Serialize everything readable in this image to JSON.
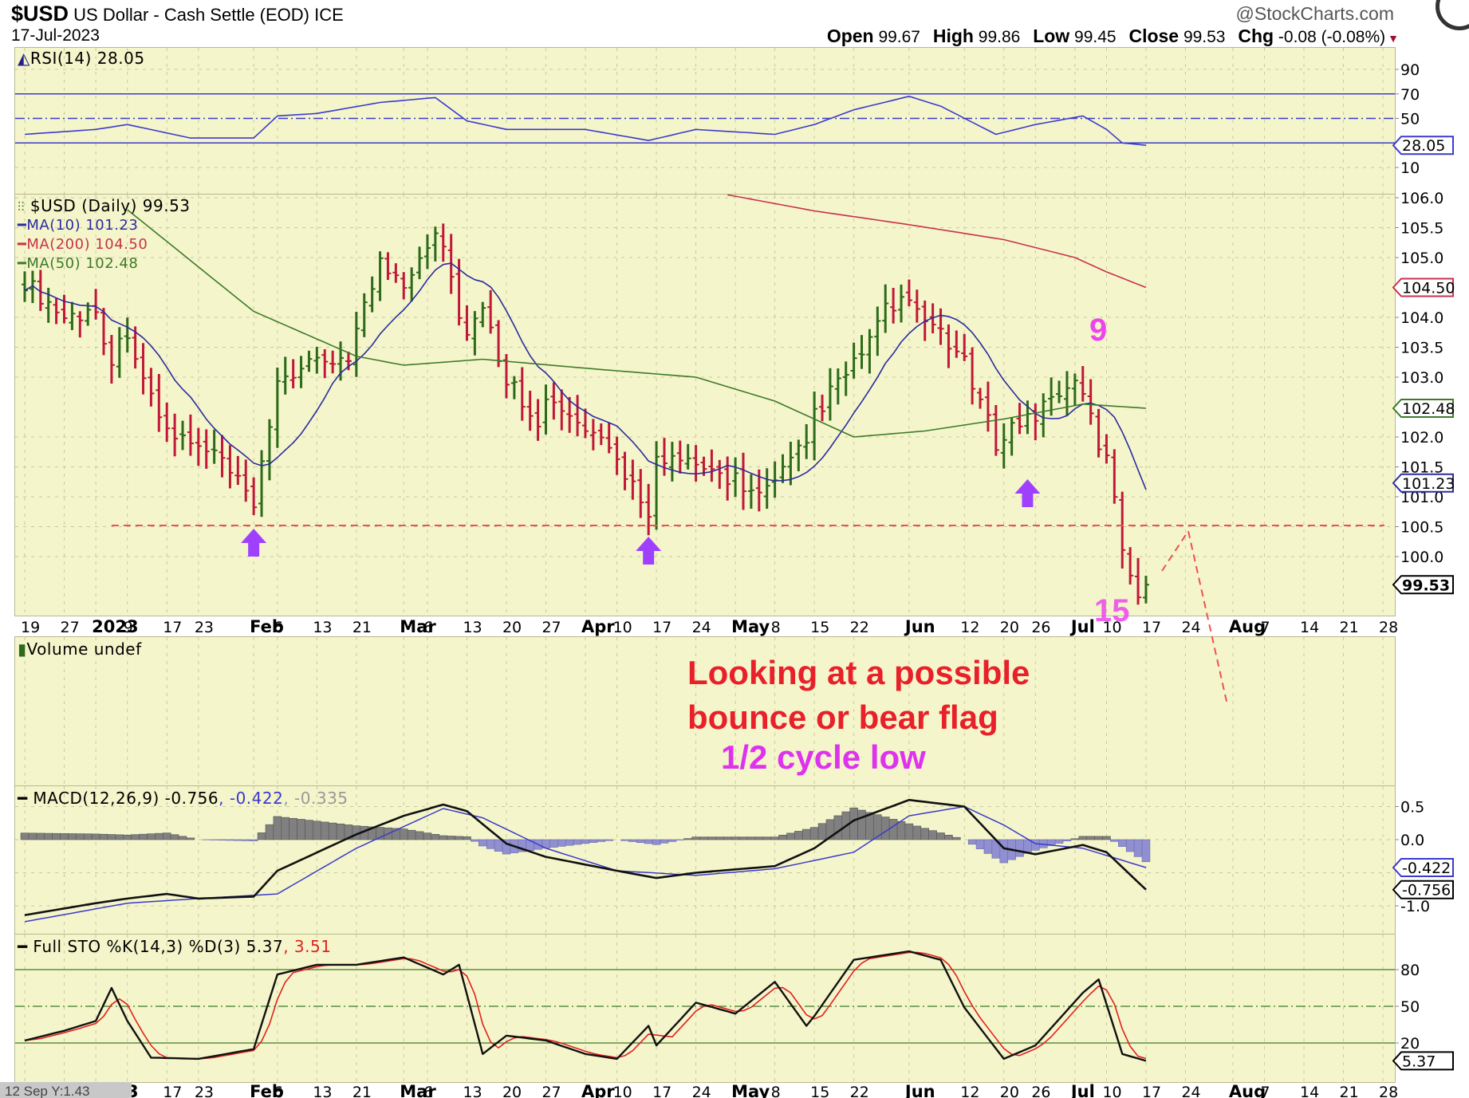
{
  "header": {
    "symbol": "$USD",
    "name": "US Dollar - Cash Settle (EOD) ICE",
    "date": "17-Jul-2023",
    "copyright": "@StockCharts.com",
    "open_label": "Open",
    "open": "99.67",
    "high_label": "High",
    "high": "99.86",
    "low_label": "Low",
    "low": "99.45",
    "close_label": "Close",
    "close": "99.53",
    "chg_label": "Chg",
    "chg": "-0.08 (-0.08%)"
  },
  "legends": {
    "rsi": "RSI(14) 28.05",
    "price": "$USD (Daily) 99.53",
    "ma10": "MA(10) 101.23",
    "ma200": "MA(200) 104.50",
    "ma50": "MA(50) 102.48",
    "volume": "Volume undef",
    "macd_name": "MACD(12,26,9) -0.756",
    "macd_signal": ", -0.422",
    "macd_hist": ", -0.335",
    "sto_name": "Full STO %K(14,3) %D(3) 5.37",
    "sto_d": ", 3.51"
  },
  "bottom_left_readout": "12 Sep Y:1.43",
  "annotations": {
    "count_high": "9",
    "count_low": "15",
    "note_line1": "Looking at a possible",
    "note_line2": "bounce or bear flag",
    "note_line3": "1/2 cycle low",
    "arrow_dates": [
      "2023-02-01",
      "2023-04-14",
      "2023-06-23"
    ],
    "support_level": 100.52
  },
  "colors": {
    "up": "#2d6a1a",
    "down": "#c01838",
    "ma10": "#2a2aa0",
    "ma50": "#3c7a28",
    "ma200": "#c8324a",
    "rsi": "#3a3acc",
    "macd": "#111111",
    "signal": "#3a3acc",
    "hist_pos": "#808080",
    "hist_neg": "#9090d0",
    "sto_k": "#111111",
    "sto_d": "#e02020",
    "note_red": "#e8202a",
    "note_magenta": "#dd33ee",
    "arrow": "#a040ff",
    "bg": "#f5f5cb"
  },
  "chart_data": {
    "type": "line",
    "title": "$USD US Dollar - Cash Settle (EOD) ICE",
    "x_range": [
      "2022-12-19",
      "2023-08-28"
    ],
    "date_labels": [
      {
        "date": "2022-12-19",
        "text": "19"
      },
      {
        "date": "2022-12-27",
        "text": "27"
      },
      {
        "date": "2023-01-03",
        "text": "2023",
        "bold": true
      },
      {
        "date": "2023-01-09",
        "text": "9"
      },
      {
        "date": "2023-01-17",
        "text": "17"
      },
      {
        "date": "2023-01-23",
        "text": "23"
      },
      {
        "date": "2023-02-01",
        "text": "Feb",
        "bold": true
      },
      {
        "date": "2023-02-06",
        "text": "6"
      },
      {
        "date": "2023-02-13",
        "text": "13"
      },
      {
        "date": "2023-02-21",
        "text": "21"
      },
      {
        "date": "2023-03-01",
        "text": "Mar",
        "bold": true
      },
      {
        "date": "2023-03-06",
        "text": "6"
      },
      {
        "date": "2023-03-13",
        "text": "13"
      },
      {
        "date": "2023-03-20",
        "text": "20"
      },
      {
        "date": "2023-03-27",
        "text": "27"
      },
      {
        "date": "2023-04-03",
        "text": "Apr",
        "bold": true
      },
      {
        "date": "2023-04-10",
        "text": "10"
      },
      {
        "date": "2023-04-17",
        "text": "17"
      },
      {
        "date": "2023-04-24",
        "text": "24"
      },
      {
        "date": "2023-05-01",
        "text": "May",
        "bold": true
      },
      {
        "date": "2023-05-08",
        "text": "8"
      },
      {
        "date": "2023-05-15",
        "text": "15"
      },
      {
        "date": "2023-05-22",
        "text": "22"
      },
      {
        "date": "2023-06-01",
        "text": "Jun",
        "bold": true
      },
      {
        "date": "2023-06-12",
        "text": "12"
      },
      {
        "date": "2023-06-20",
        "text": "20"
      },
      {
        "date": "2023-06-26",
        "text": "26"
      },
      {
        "date": "2023-07-03",
        "text": "Jul",
        "bold": true
      },
      {
        "date": "2023-07-10",
        "text": "10"
      },
      {
        "date": "2023-07-17",
        "text": "17"
      },
      {
        "date": "2023-07-24",
        "text": "24"
      },
      {
        "date": "2023-08-01",
        "text": "Aug",
        "bold": true
      },
      {
        "date": "2023-08-07",
        "text": "7"
      },
      {
        "date": "2023-08-14",
        "text": "14"
      },
      {
        "date": "2023-08-21",
        "text": "21"
      },
      {
        "date": "2023-08-28",
        "text": "28"
      }
    ],
    "price": {
      "ylim": [
        99.3,
        106.1
      ],
      "ticks": [
        106.0,
        105.5,
        105.0,
        104.0,
        103.5,
        103.0,
        102.0,
        101.5,
        101.0,
        100.5,
        100.0
      ],
      "close": [
        [
          "2022-12-19",
          104.6
        ],
        [
          "2022-12-27",
          104.0
        ],
        [
          "2023-01-03",
          104.1
        ],
        [
          "2023-01-05",
          103.3
        ],
        [
          "2023-01-09",
          103.8
        ],
        [
          "2023-01-12",
          102.6
        ],
        [
          "2023-01-17",
          102.1
        ],
        [
          "2023-01-23",
          101.8
        ],
        [
          "2023-01-26",
          101.6
        ],
        [
          "2023-02-01",
          100.8
        ],
        [
          "2023-02-03",
          102.1
        ],
        [
          "2023-02-06",
          103.0
        ],
        [
          "2023-02-13",
          103.2
        ],
        [
          "2023-02-17",
          103.4
        ],
        [
          "2023-02-21",
          103.8
        ],
        [
          "2023-02-24",
          104.9
        ],
        [
          "2023-03-01",
          104.6
        ],
        [
          "2023-03-07",
          105.5
        ],
        [
          "2023-03-08",
          105.2
        ],
        [
          "2023-03-10",
          104.1
        ],
        [
          "2023-03-13",
          103.7
        ],
        [
          "2023-03-15",
          104.1
        ],
        [
          "2023-03-20",
          103.0
        ],
        [
          "2023-03-24",
          102.3
        ],
        [
          "2023-03-27",
          102.6
        ],
        [
          "2023-04-03",
          102.1
        ],
        [
          "2023-04-10",
          101.6
        ],
        [
          "2023-04-14",
          100.8
        ],
        [
          "2023-04-17",
          101.6
        ],
        [
          "2023-04-24",
          101.5
        ],
        [
          "2023-05-01",
          101.3
        ],
        [
          "2023-05-04",
          101.0
        ],
        [
          "2023-05-08",
          101.2
        ],
        [
          "2023-05-12",
          101.9
        ],
        [
          "2023-05-15",
          102.4
        ],
        [
          "2023-05-22",
          103.2
        ],
        [
          "2023-05-26",
          104.1
        ],
        [
          "2023-05-31",
          104.3
        ],
        [
          "2023-06-02",
          104.0
        ],
        [
          "2023-06-07",
          103.8
        ],
        [
          "2023-06-12",
          103.2
        ],
        [
          "2023-06-16",
          101.9
        ],
        [
          "2023-06-20",
          102.1
        ],
        [
          "2023-06-23",
          102.3
        ],
        [
          "2023-06-26",
          102.4
        ],
        [
          "2023-06-30",
          102.9
        ],
        [
          "2023-07-05",
          102.7
        ],
        [
          "2023-07-07",
          101.9
        ],
        [
          "2023-07-10",
          101.6
        ],
        [
          "2023-07-12",
          100.2
        ],
        [
          "2023-07-13",
          99.7
        ],
        [
          "2023-07-14",
          99.4
        ],
        [
          "2023-07-17",
          99.53
        ]
      ],
      "ma50": [
        [
          "2023-01-09",
          105.8
        ],
        [
          "2023-02-01",
          104.1
        ],
        [
          "2023-02-21",
          103.35
        ],
        [
          "2023-03-01",
          103.2
        ],
        [
          "2023-03-15",
          103.3
        ],
        [
          "2023-04-03",
          103.15
        ],
        [
          "2023-04-24",
          103.0
        ],
        [
          "2023-05-08",
          102.6
        ],
        [
          "2023-05-22",
          102.0
        ],
        [
          "2023-06-05",
          102.1
        ],
        [
          "2023-06-20",
          102.3
        ],
        [
          "2023-07-05",
          102.55
        ],
        [
          "2023-07-17",
          102.48
        ]
      ],
      "ma200": [
        [
          "2023-04-28",
          106.05
        ],
        [
          "2023-05-15",
          105.78
        ],
        [
          "2023-06-01",
          105.55
        ],
        [
          "2023-06-20",
          105.3
        ],
        [
          "2023-07-03",
          105.0
        ],
        [
          "2023-07-10",
          104.76
        ],
        [
          "2023-07-17",
          104.5
        ]
      ],
      "last": {
        "close": "99.53",
        "ma10": "101.23",
        "ma50": "102.48",
        "ma200": "104.50"
      }
    },
    "rsi": {
      "ticks": [
        "90",
        "70",
        "50",
        "10"
      ],
      "levels": [
        70,
        50,
        30
      ],
      "last": "28.05",
      "values": [
        [
          "2022-12-19",
          37
        ],
        [
          "2023-01-03",
          41
        ],
        [
          "2023-01-09",
          45
        ],
        [
          "2023-01-20",
          34
        ],
        [
          "2023-02-01",
          34
        ],
        [
          "2023-02-06",
          52
        ],
        [
          "2023-02-13",
          54
        ],
        [
          "2023-02-24",
          63
        ],
        [
          "2023-03-07",
          67
        ],
        [
          "2023-03-13",
          48
        ],
        [
          "2023-03-20",
          41
        ],
        [
          "2023-04-03",
          41
        ],
        [
          "2023-04-14",
          32
        ],
        [
          "2023-04-24",
          41
        ],
        [
          "2023-05-08",
          37
        ],
        [
          "2023-05-15",
          45
        ],
        [
          "2023-05-22",
          57
        ],
        [
          "2023-06-01",
          68
        ],
        [
          "2023-06-07",
          60
        ],
        [
          "2023-06-16",
          37
        ],
        [
          "2023-06-26",
          45
        ],
        [
          "2023-07-05",
          52
        ],
        [
          "2023-07-10",
          41
        ],
        [
          "2023-07-12",
          30
        ],
        [
          "2023-07-17",
          28.05
        ]
      ]
    },
    "macd": {
      "ticks": [
        "0.5",
        "0.0",
        "-1.0"
      ],
      "last_macd": "-0.756",
      "last_signal": "-0.422",
      "macd": [
        [
          "2022-12-19",
          -1.14
        ],
        [
          "2023-01-03",
          -0.96
        ],
        [
          "2023-01-09",
          -0.89
        ],
        [
          "2023-01-17",
          -0.82
        ],
        [
          "2023-01-23",
          -0.89
        ],
        [
          "2023-02-01",
          -0.86
        ],
        [
          "2023-02-06",
          -0.47
        ],
        [
          "2023-02-21",
          0.08
        ],
        [
          "2023-03-01",
          0.36
        ],
        [
          "2023-03-08",
          0.53
        ],
        [
          "2023-03-13",
          0.43
        ],
        [
          "2023-03-20",
          -0.06
        ],
        [
          "2023-03-27",
          -0.26
        ],
        [
          "2023-04-10",
          -0.47
        ],
        [
          "2023-04-17",
          -0.58
        ],
        [
          "2023-04-24",
          -0.5
        ],
        [
          "2023-05-08",
          -0.4
        ],
        [
          "2023-05-15",
          -0.13
        ],
        [
          "2023-05-22",
          0.29
        ],
        [
          "2023-06-01",
          0.6
        ],
        [
          "2023-06-12",
          0.5
        ],
        [
          "2023-06-20",
          -0.13
        ],
        [
          "2023-06-26",
          -0.22
        ],
        [
          "2023-07-05",
          -0.08
        ],
        [
          "2023-07-10",
          -0.19
        ],
        [
          "2023-07-17",
          -0.756
        ]
      ],
      "signal": [
        [
          "2022-12-19",
          -1.24
        ],
        [
          "2023-01-09",
          -0.96
        ],
        [
          "2023-01-23",
          -0.89
        ],
        [
          "2023-02-06",
          -0.82
        ],
        [
          "2023-02-21",
          -0.13
        ],
        [
          "2023-03-08",
          0.47
        ],
        [
          "2023-03-15",
          0.33
        ],
        [
          "2023-03-27",
          -0.13
        ],
        [
          "2023-04-10",
          -0.47
        ],
        [
          "2023-04-24",
          -0.54
        ],
        [
          "2023-05-08",
          -0.44
        ],
        [
          "2023-05-22",
          -0.19
        ],
        [
          "2023-06-01",
          0.36
        ],
        [
          "2023-06-12",
          0.5
        ],
        [
          "2023-06-20",
          0.22
        ],
        [
          "2023-06-26",
          -0.06
        ],
        [
          "2023-07-05",
          -0.13
        ],
        [
          "2023-07-17",
          -0.422
        ]
      ]
    },
    "sto": {
      "ticks": [
        "80",
        "50",
        "20"
      ],
      "levels": [
        80,
        50,
        20
      ],
      "last_k": "5.37",
      "k": [
        [
          "2022-12-19",
          22
        ],
        [
          "2022-12-27",
          30
        ],
        [
          "2023-01-03",
          38
        ],
        [
          "2023-01-05",
          65
        ],
        [
          "2023-01-09",
          38
        ],
        [
          "2023-01-12",
          8
        ],
        [
          "2023-01-23",
          7
        ],
        [
          "2023-02-01",
          15
        ],
        [
          "2023-02-06",
          76
        ],
        [
          "2023-02-13",
          84
        ],
        [
          "2023-02-21",
          84
        ],
        [
          "2023-03-01",
          90
        ],
        [
          "2023-03-08",
          76
        ],
        [
          "2023-03-10",
          84
        ],
        [
          "2023-03-15",
          11
        ],
        [
          "2023-03-20",
          26
        ],
        [
          "2023-03-27",
          22
        ],
        [
          "2023-04-03",
          11
        ],
        [
          "2023-04-10",
          7
        ],
        [
          "2023-04-14",
          34
        ],
        [
          "2023-04-17",
          18
        ],
        [
          "2023-04-24",
          53
        ],
        [
          "2023-05-01",
          44
        ],
        [
          "2023-05-08",
          70
        ],
        [
          "2023-05-12",
          34
        ],
        [
          "2023-05-15",
          42
        ],
        [
          "2023-05-22",
          88
        ],
        [
          "2023-06-01",
          95
        ],
        [
          "2023-06-07",
          88
        ],
        [
          "2023-06-12",
          49
        ],
        [
          "2023-06-20",
          7
        ],
        [
          "2023-06-26",
          18
        ],
        [
          "2023-07-05",
          61
        ],
        [
          "2023-07-07",
          72
        ],
        [
          "2023-07-12",
          11
        ],
        [
          "2023-07-17",
          5.37
        ]
      ]
    }
  }
}
